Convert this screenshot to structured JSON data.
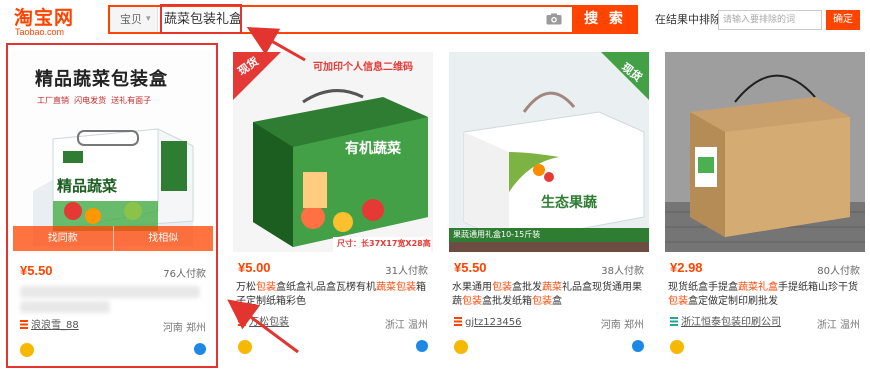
{
  "header": {
    "logo_main": "淘宝网",
    "logo_sub": "Taobao.com",
    "category": "宝贝",
    "category_arrow": "▾",
    "query": "蔬菜包装礼盒",
    "search_label": "搜 索",
    "refine_label": "在结果中排除",
    "refine_placeholder": "请输入要排除的词",
    "refine_button": "确定"
  },
  "products": [
    {
      "price": "¥5.50",
      "sold": "76人付款",
      "shop": "浪浪雪_88",
      "location": "河南 郑州",
      "img_btn_left": "找同款",
      "img_btn_right": "找相似",
      "img_title": "精品蔬菜包装盒",
      "img_tags": "工厂直销  闪电发货  送礼有面子",
      "box_text": "精品蔬菜"
    },
    {
      "price": "¥5.00",
      "sold": "31人付款",
      "title_parts": [
        "万松",
        "包装",
        "盒纸盒礼品盒瓦楞有机",
        "蔬菜",
        "包",
        "装",
        "箱子定制纸箱彩色"
      ],
      "shop": "万松包装",
      "location": "浙江 温州",
      "banner_tag": "现货",
      "img_note": "可加印个人信息二维码",
      "box_text": "有机蔬菜",
      "size_note": "尺寸：长37X17宽X28高"
    },
    {
      "price": "¥5.50",
      "sold": "38人付款",
      "title_parts": [
        "水果通用",
        "包装",
        "盒批发",
        "蔬菜",
        "礼品盒现货通用果蔬",
        "包装",
        "盒批发纸箱",
        "包装",
        "盒"
      ],
      "shop": "gjtz123456",
      "location": "河南 郑州",
      "banner_tag": "现货",
      "box_text": "生态果蔬",
      "strip_note": "果蔬通用礼盒10-15斤装"
    },
    {
      "price": "¥2.98",
      "sold": "80人付款",
      "title_parts": [
        "现货纸盒手提盒",
        "蔬菜礼盒",
        "手提纸箱山珍干货",
        "包装",
        "盒定做定制印刷批发"
      ],
      "shop": "浙江恒泰包装印刷公司",
      "location": "浙江 温州"
    }
  ],
  "colors": {
    "accent": "#ff4400",
    "highlight": "#e3342f"
  }
}
